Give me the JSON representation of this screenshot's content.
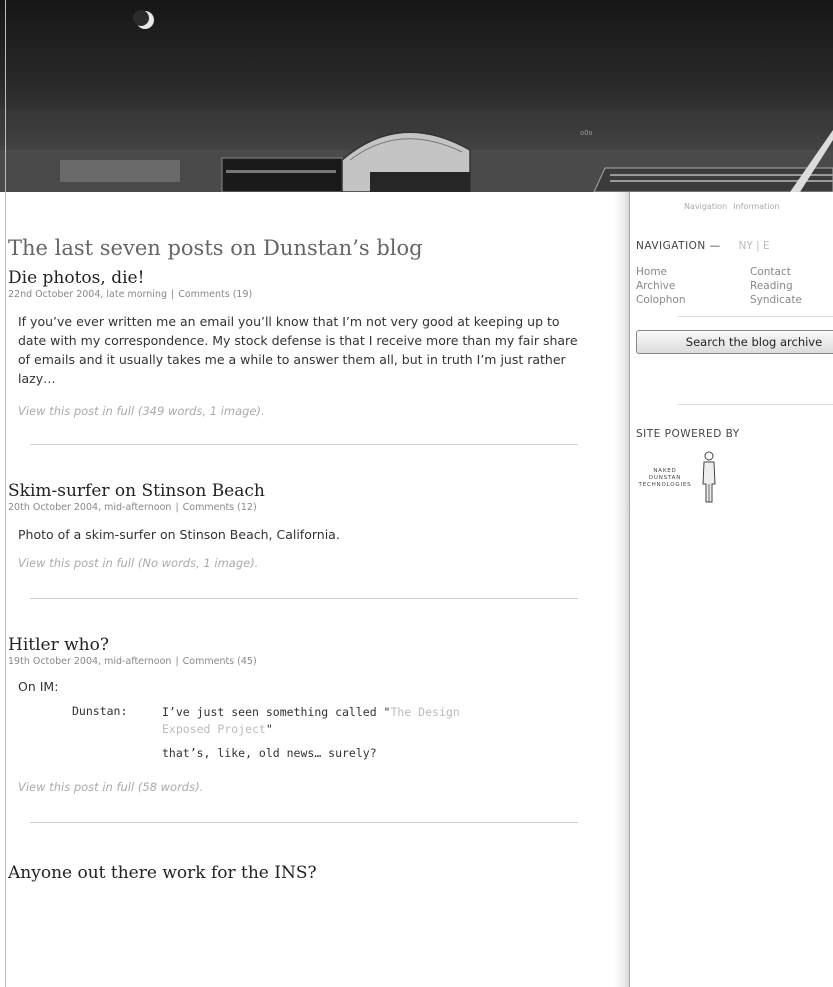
{
  "page_title": "The last seven posts on Dunstan’s blog",
  "posts": [
    {
      "title": "Die photos, die!",
      "date": "22nd October 2004, late morning",
      "comments": "Comments (19)",
      "excerpt": "If you’ve ever written me an email you’ll know that I’m not very good at keeping up to date with my correspondence. My stock defense is that I receive more than my fair share of emails and it usually takes me a while to answer them all, but in truth I’m just rather lazy…",
      "more": "View this post in full (349 words, 1 image)."
    },
    {
      "title": "Skim-surfer on Stinson Beach",
      "date": "20th October 2004, mid-afternoon",
      "comments": "Comments (12)",
      "excerpt": "Photo of a skim-surfer on Stinson Beach, California.",
      "more": "View this post in full (No words, 1 image)."
    },
    {
      "title": "Hitler who?",
      "date": "19th October 2004, mid-afternoon",
      "comments": "Comments (45)",
      "im_label": "On IM:",
      "chat_who": "Dunstan:",
      "chat_msg_start": "I’ve just seen something called \"",
      "chat_msg_link": "The Design Exposed Project",
      "chat_msg_end": "\"",
      "chat_reply": "that’s, like, old news… surely?",
      "more": "View this post in full (58 words)."
    },
    {
      "title": "Anyone out there work for the INS?"
    }
  ],
  "sidebar": {
    "tabs": [
      "Navigation",
      "Information"
    ],
    "nav_heading": "NAVIGATION —",
    "nav_heading_extra": "NY | E",
    "nav_items": [
      [
        "Home",
        "Contact"
      ],
      [
        "Archive",
        "Reading"
      ],
      [
        "Colophon",
        "Syndicate"
      ]
    ],
    "search_label": "Search the blog archive",
    "powered_heading": "SITE POWERED BY",
    "logo_text": [
      "NAKED",
      "DUNSTAN",
      "TECHNOLOGIES"
    ]
  },
  "colors": {
    "banner_dark": "#161616",
    "text": "#333333",
    "muted": "#888888",
    "link_light": "#aaaaaa"
  }
}
